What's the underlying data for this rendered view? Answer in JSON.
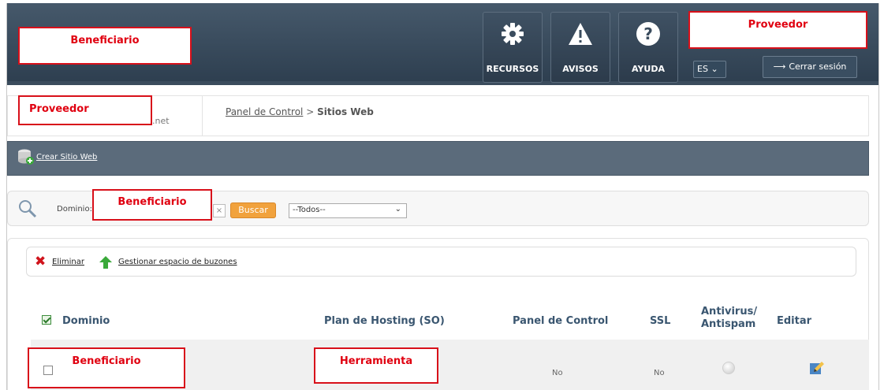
{
  "header": {
    "beneficiary_box": "Beneficiario",
    "provider_box": "Proveedor",
    "nav": [
      {
        "label": "RECURSOS",
        "icon": "gear-icon"
      },
      {
        "label": "AVISOS",
        "icon": "warning-icon"
      },
      {
        "label": "AYUDA",
        "icon": "help-icon"
      }
    ],
    "language": "ES",
    "logout_glyph": "⟶",
    "logout_label": "Cerrar sesión"
  },
  "breadcrumb": {
    "provider_box": "Proveedor",
    "domain_suffix": ".net",
    "items": [
      "Panel de Control",
      "Sitios Web"
    ],
    "separator": ">"
  },
  "actions": {
    "create_label": "Crear Sitio Web"
  },
  "search": {
    "label": "Dominio:",
    "beneficiary_box": "Beneficiario",
    "clear": "×",
    "button_label": "Buscar",
    "filter_value": "--Todos--"
  },
  "toolbar": {
    "delete_label": "Eliminar",
    "manage_label": "Gestionar espacio de buzones"
  },
  "table": {
    "columns": [
      "Dominio",
      "Plan de Hosting (SO)",
      "Panel de Control",
      "SSL",
      "Antivirus/ Antispam",
      "Editar"
    ],
    "rows": [
      {
        "domain_box": "Beneficiario",
        "plan_box": "Herramienta",
        "panel": "No",
        "ssl": "No"
      }
    ]
  },
  "colors": {
    "header": "#3b4c5d",
    "accent": "#f1a23d",
    "annotation": "#d8101a",
    "column_header": "#3a5670"
  }
}
